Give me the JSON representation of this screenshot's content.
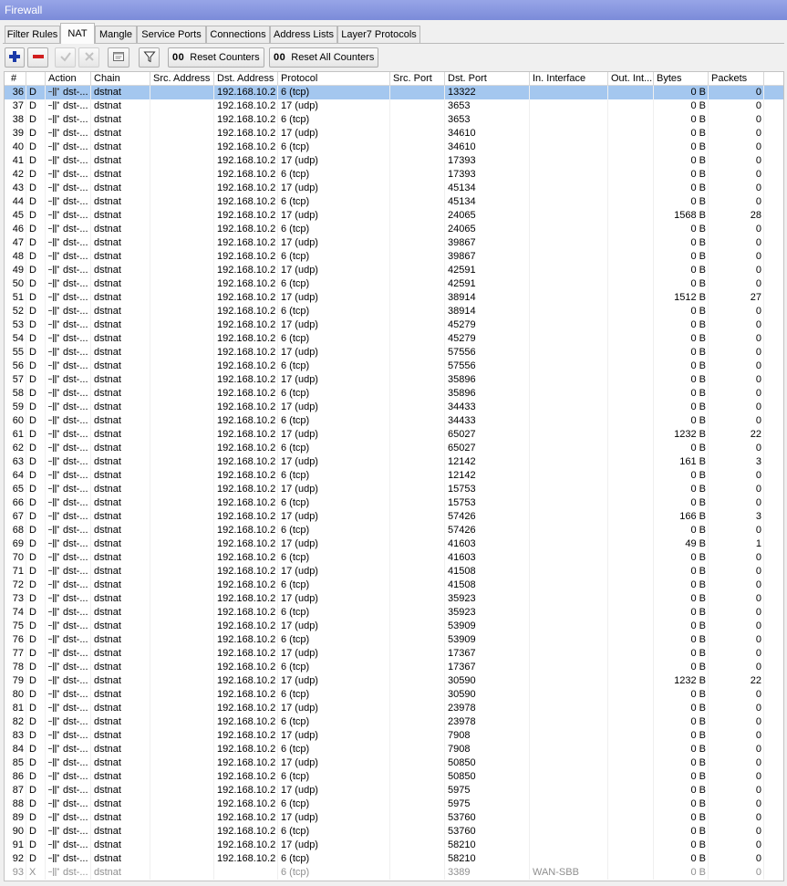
{
  "window": {
    "title": "Firewall"
  },
  "tabs": [
    "Filter Rules",
    "NAT",
    "Mangle",
    "Service Ports",
    "Connections",
    "Address Lists",
    "Layer7 Protocols"
  ],
  "active_tab": "NAT",
  "toolbar": {
    "add_icon": "plus-icon",
    "remove_icon": "minus-icon",
    "enable_icon": "check-icon",
    "disable_icon": "x-icon",
    "comment_icon": "comment-icon",
    "filter_icon": "filter-icon",
    "reset_counters": {
      "prefix": "00",
      "label": "Reset Counters"
    },
    "reset_all_counters": {
      "prefix": "00",
      "label": "Reset All Counters"
    }
  },
  "table": {
    "columns": [
      "#",
      "",
      "Action",
      "Chain",
      "Src. Address",
      "Dst. Address",
      "Protocol",
      "Src. Port",
      "Dst. Port",
      "In. Interface",
      "Out. Int...",
      "Bytes",
      "Packets"
    ],
    "action_icon": "dst-nat-icon",
    "selected_row": "36",
    "rows": [
      [
        "36",
        "D",
        "dst-...",
        "dstnat",
        "",
        "192.168.10.2",
        "6 (tcp)",
        "",
        "13322",
        "",
        "",
        "0 B",
        "0"
      ],
      [
        "37",
        "D",
        "dst-...",
        "dstnat",
        "",
        "192.168.10.2",
        "17 (udp)",
        "",
        "3653",
        "",
        "",
        "0 B",
        "0"
      ],
      [
        "38",
        "D",
        "dst-...",
        "dstnat",
        "",
        "192.168.10.2",
        "6 (tcp)",
        "",
        "3653",
        "",
        "",
        "0 B",
        "0"
      ],
      [
        "39",
        "D",
        "dst-...",
        "dstnat",
        "",
        "192.168.10.2",
        "17 (udp)",
        "",
        "34610",
        "",
        "",
        "0 B",
        "0"
      ],
      [
        "40",
        "D",
        "dst-...",
        "dstnat",
        "",
        "192.168.10.2",
        "6 (tcp)",
        "",
        "34610",
        "",
        "",
        "0 B",
        "0"
      ],
      [
        "41",
        "D",
        "dst-...",
        "dstnat",
        "",
        "192.168.10.2",
        "17 (udp)",
        "",
        "17393",
        "",
        "",
        "0 B",
        "0"
      ],
      [
        "42",
        "D",
        "dst-...",
        "dstnat",
        "",
        "192.168.10.2",
        "6 (tcp)",
        "",
        "17393",
        "",
        "",
        "0 B",
        "0"
      ],
      [
        "43",
        "D",
        "dst-...",
        "dstnat",
        "",
        "192.168.10.2",
        "17 (udp)",
        "",
        "45134",
        "",
        "",
        "0 B",
        "0"
      ],
      [
        "44",
        "D",
        "dst-...",
        "dstnat",
        "",
        "192.168.10.2",
        "6 (tcp)",
        "",
        "45134",
        "",
        "",
        "0 B",
        "0"
      ],
      [
        "45",
        "D",
        "dst-...",
        "dstnat",
        "",
        "192.168.10.2",
        "17 (udp)",
        "",
        "24065",
        "",
        "",
        "1568 B",
        "28"
      ],
      [
        "46",
        "D",
        "dst-...",
        "dstnat",
        "",
        "192.168.10.2",
        "6 (tcp)",
        "",
        "24065",
        "",
        "",
        "0 B",
        "0"
      ],
      [
        "47",
        "D",
        "dst-...",
        "dstnat",
        "",
        "192.168.10.2",
        "17 (udp)",
        "",
        "39867",
        "",
        "",
        "0 B",
        "0"
      ],
      [
        "48",
        "D",
        "dst-...",
        "dstnat",
        "",
        "192.168.10.2",
        "6 (tcp)",
        "",
        "39867",
        "",
        "",
        "0 B",
        "0"
      ],
      [
        "49",
        "D",
        "dst-...",
        "dstnat",
        "",
        "192.168.10.2",
        "17 (udp)",
        "",
        "42591",
        "",
        "",
        "0 B",
        "0"
      ],
      [
        "50",
        "D",
        "dst-...",
        "dstnat",
        "",
        "192.168.10.2",
        "6 (tcp)",
        "",
        "42591",
        "",
        "",
        "0 B",
        "0"
      ],
      [
        "51",
        "D",
        "dst-...",
        "dstnat",
        "",
        "192.168.10.2",
        "17 (udp)",
        "",
        "38914",
        "",
        "",
        "1512 B",
        "27"
      ],
      [
        "52",
        "D",
        "dst-...",
        "dstnat",
        "",
        "192.168.10.2",
        "6 (tcp)",
        "",
        "38914",
        "",
        "",
        "0 B",
        "0"
      ],
      [
        "53",
        "D",
        "dst-...",
        "dstnat",
        "",
        "192.168.10.2",
        "17 (udp)",
        "",
        "45279",
        "",
        "",
        "0 B",
        "0"
      ],
      [
        "54",
        "D",
        "dst-...",
        "dstnat",
        "",
        "192.168.10.2",
        "6 (tcp)",
        "",
        "45279",
        "",
        "",
        "0 B",
        "0"
      ],
      [
        "55",
        "D",
        "dst-...",
        "dstnat",
        "",
        "192.168.10.2",
        "17 (udp)",
        "",
        "57556",
        "",
        "",
        "0 B",
        "0"
      ],
      [
        "56",
        "D",
        "dst-...",
        "dstnat",
        "",
        "192.168.10.2",
        "6 (tcp)",
        "",
        "57556",
        "",
        "",
        "0 B",
        "0"
      ],
      [
        "57",
        "D",
        "dst-...",
        "dstnat",
        "",
        "192.168.10.2",
        "17 (udp)",
        "",
        "35896",
        "",
        "",
        "0 B",
        "0"
      ],
      [
        "58",
        "D",
        "dst-...",
        "dstnat",
        "",
        "192.168.10.2",
        "6 (tcp)",
        "",
        "35896",
        "",
        "",
        "0 B",
        "0"
      ],
      [
        "59",
        "D",
        "dst-...",
        "dstnat",
        "",
        "192.168.10.2",
        "17 (udp)",
        "",
        "34433",
        "",
        "",
        "0 B",
        "0"
      ],
      [
        "60",
        "D",
        "dst-...",
        "dstnat",
        "",
        "192.168.10.2",
        "6 (tcp)",
        "",
        "34433",
        "",
        "",
        "0 B",
        "0"
      ],
      [
        "61",
        "D",
        "dst-...",
        "dstnat",
        "",
        "192.168.10.2",
        "17 (udp)",
        "",
        "65027",
        "",
        "",
        "1232 B",
        "22"
      ],
      [
        "62",
        "D",
        "dst-...",
        "dstnat",
        "",
        "192.168.10.2",
        "6 (tcp)",
        "",
        "65027",
        "",
        "",
        "0 B",
        "0"
      ],
      [
        "63",
        "D",
        "dst-...",
        "dstnat",
        "",
        "192.168.10.2",
        "17 (udp)",
        "",
        "12142",
        "",
        "",
        "161 B",
        "3"
      ],
      [
        "64",
        "D",
        "dst-...",
        "dstnat",
        "",
        "192.168.10.2",
        "6 (tcp)",
        "",
        "12142",
        "",
        "",
        "0 B",
        "0"
      ],
      [
        "65",
        "D",
        "dst-...",
        "dstnat",
        "",
        "192.168.10.2",
        "17 (udp)",
        "",
        "15753",
        "",
        "",
        "0 B",
        "0"
      ],
      [
        "66",
        "D",
        "dst-...",
        "dstnat",
        "",
        "192.168.10.2",
        "6 (tcp)",
        "",
        "15753",
        "",
        "",
        "0 B",
        "0"
      ],
      [
        "67",
        "D",
        "dst-...",
        "dstnat",
        "",
        "192.168.10.2",
        "17 (udp)",
        "",
        "57426",
        "",
        "",
        "166 B",
        "3"
      ],
      [
        "68",
        "D",
        "dst-...",
        "dstnat",
        "",
        "192.168.10.2",
        "6 (tcp)",
        "",
        "57426",
        "",
        "",
        "0 B",
        "0"
      ],
      [
        "69",
        "D",
        "dst-...",
        "dstnat",
        "",
        "192.168.10.2",
        "17 (udp)",
        "",
        "41603",
        "",
        "",
        "49 B",
        "1"
      ],
      [
        "70",
        "D",
        "dst-...",
        "dstnat",
        "",
        "192.168.10.2",
        "6 (tcp)",
        "",
        "41603",
        "",
        "",
        "0 B",
        "0"
      ],
      [
        "71",
        "D",
        "dst-...",
        "dstnat",
        "",
        "192.168.10.2",
        "17 (udp)",
        "",
        "41508",
        "",
        "",
        "0 B",
        "0"
      ],
      [
        "72",
        "D",
        "dst-...",
        "dstnat",
        "",
        "192.168.10.2",
        "6 (tcp)",
        "",
        "41508",
        "",
        "",
        "0 B",
        "0"
      ],
      [
        "73",
        "D",
        "dst-...",
        "dstnat",
        "",
        "192.168.10.2",
        "17 (udp)",
        "",
        "35923",
        "",
        "",
        "0 B",
        "0"
      ],
      [
        "74",
        "D",
        "dst-...",
        "dstnat",
        "",
        "192.168.10.2",
        "6 (tcp)",
        "",
        "35923",
        "",
        "",
        "0 B",
        "0"
      ],
      [
        "75",
        "D",
        "dst-...",
        "dstnat",
        "",
        "192.168.10.2",
        "17 (udp)",
        "",
        "53909",
        "",
        "",
        "0 B",
        "0"
      ],
      [
        "76",
        "D",
        "dst-...",
        "dstnat",
        "",
        "192.168.10.2",
        "6 (tcp)",
        "",
        "53909",
        "",
        "",
        "0 B",
        "0"
      ],
      [
        "77",
        "D",
        "dst-...",
        "dstnat",
        "",
        "192.168.10.2",
        "17 (udp)",
        "",
        "17367",
        "",
        "",
        "0 B",
        "0"
      ],
      [
        "78",
        "D",
        "dst-...",
        "dstnat",
        "",
        "192.168.10.2",
        "6 (tcp)",
        "",
        "17367",
        "",
        "",
        "0 B",
        "0"
      ],
      [
        "79",
        "D",
        "dst-...",
        "dstnat",
        "",
        "192.168.10.2",
        "17 (udp)",
        "",
        "30590",
        "",
        "",
        "1232 B",
        "22"
      ],
      [
        "80",
        "D",
        "dst-...",
        "dstnat",
        "",
        "192.168.10.2",
        "6 (tcp)",
        "",
        "30590",
        "",
        "",
        "0 B",
        "0"
      ],
      [
        "81",
        "D",
        "dst-...",
        "dstnat",
        "",
        "192.168.10.2",
        "17 (udp)",
        "",
        "23978",
        "",
        "",
        "0 B",
        "0"
      ],
      [
        "82",
        "D",
        "dst-...",
        "dstnat",
        "",
        "192.168.10.2",
        "6 (tcp)",
        "",
        "23978",
        "",
        "",
        "0 B",
        "0"
      ],
      [
        "83",
        "D",
        "dst-...",
        "dstnat",
        "",
        "192.168.10.2",
        "17 (udp)",
        "",
        "7908",
        "",
        "",
        "0 B",
        "0"
      ],
      [
        "84",
        "D",
        "dst-...",
        "dstnat",
        "",
        "192.168.10.2",
        "6 (tcp)",
        "",
        "7908",
        "",
        "",
        "0 B",
        "0"
      ],
      [
        "85",
        "D",
        "dst-...",
        "dstnat",
        "",
        "192.168.10.2",
        "17 (udp)",
        "",
        "50850",
        "",
        "",
        "0 B",
        "0"
      ],
      [
        "86",
        "D",
        "dst-...",
        "dstnat",
        "",
        "192.168.10.2",
        "6 (tcp)",
        "",
        "50850",
        "",
        "",
        "0 B",
        "0"
      ],
      [
        "87",
        "D",
        "dst-...",
        "dstnat",
        "",
        "192.168.10.2",
        "17 (udp)",
        "",
        "5975",
        "",
        "",
        "0 B",
        "0"
      ],
      [
        "88",
        "D",
        "dst-...",
        "dstnat",
        "",
        "192.168.10.2",
        "6 (tcp)",
        "",
        "5975",
        "",
        "",
        "0 B",
        "0"
      ],
      [
        "89",
        "D",
        "dst-...",
        "dstnat",
        "",
        "192.168.10.2",
        "17 (udp)",
        "",
        "53760",
        "",
        "",
        "0 B",
        "0"
      ],
      [
        "90",
        "D",
        "dst-...",
        "dstnat",
        "",
        "192.168.10.2",
        "6 (tcp)",
        "",
        "53760",
        "",
        "",
        "0 B",
        "0"
      ],
      [
        "91",
        "D",
        "dst-...",
        "dstnat",
        "",
        "192.168.10.2",
        "17 (udp)",
        "",
        "58210",
        "",
        "",
        "0 B",
        "0"
      ],
      [
        "92",
        "D",
        "dst-...",
        "dstnat",
        "",
        "192.168.10.2",
        "6 (tcp)",
        "",
        "58210",
        "",
        "",
        "0 B",
        "0"
      ],
      [
        "93",
        "X",
        "dst-...",
        "dstnat",
        "",
        "",
        "6 (tcp)",
        "",
        "3389",
        "WAN-SBB",
        "",
        "0 B",
        "0"
      ]
    ]
  },
  "colors": {
    "title_bar": "#7b8bd9",
    "selected_row": "#a4c7ef",
    "disabled_text": "#8f8f8f",
    "add_icon": "#1b3aa8",
    "remove_icon": "#d11f1f"
  }
}
